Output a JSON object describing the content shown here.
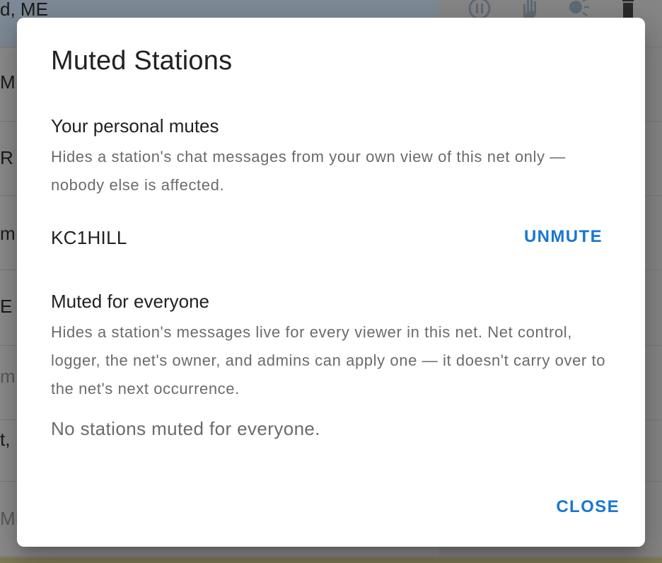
{
  "background": {
    "row_fragments": [
      "d, ME",
      "M",
      "R",
      "m,",
      "E",
      "m,",
      "t, I",
      "ME"
    ]
  },
  "dialog": {
    "title": "Muted Stations",
    "personal": {
      "heading": "Your personal mutes",
      "description": "Hides a station's chat messages from your own view of this net only — nobody else is affected.",
      "items": [
        {
          "callsign": "KC1HILL",
          "action_label": "UNMUTE"
        }
      ]
    },
    "everyone": {
      "heading": "Muted for everyone",
      "description": "Hides a station's messages live for every viewer in this net. Net control, logger, the net's owner, and admins can apply one — it doesn't carry over to the net's next occurrence.",
      "empty_text": "No stations muted for everyone."
    },
    "close_label": "CLOSE"
  },
  "colors": {
    "accent": "#1976d2",
    "title_text": "#212121",
    "secondary_text": "#6b6b6b",
    "overlay_background": "#8c8c8c"
  },
  "icons": [
    "pause-icon",
    "raised-hand-icon",
    "speak-icon",
    "delete-icon"
  ]
}
